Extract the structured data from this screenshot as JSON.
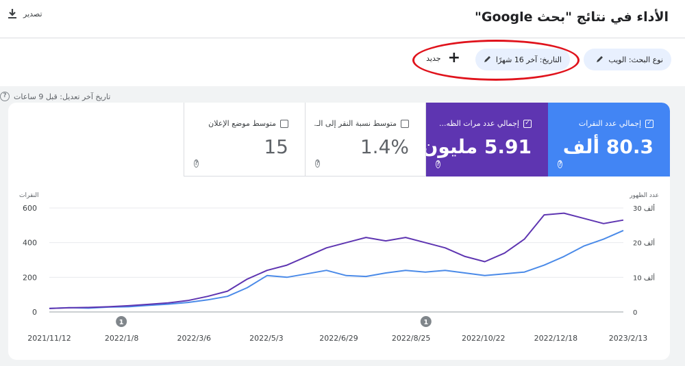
{
  "header": {
    "title": "الأداء في نتائج \"بحث Google\"",
    "export_label": "تصدير"
  },
  "filters": {
    "search_type": "نوع البحث: الويب",
    "date": "التاريخ: آخر 16 شهرًا",
    "add_new": "جديد",
    "last_update": "تاريخ آخر تعديل: قبل 9 ساعات"
  },
  "metrics": [
    {
      "label": "إجمالي عدد النقرات",
      "value": "80.3 ألف",
      "checked": true,
      "color": "#4285f4"
    },
    {
      "label": "إجمالي عدد مرات الظه...",
      "value": "5.91 مليون",
      "checked": true,
      "color": "#5e35b1"
    },
    {
      "label": "متوسط نسبة النقر إلى الـ...",
      "value": "1.4%",
      "checked": false
    },
    {
      "label": "متوسط موضع الإعلان",
      "value": "15",
      "checked": false
    }
  ],
  "chart_data": {
    "type": "line",
    "left_axis_label": "النقرات",
    "right_axis_label": "عدد الظهور",
    "left_ticks": [
      "600",
      "400",
      "200",
      "0"
    ],
    "right_ticks": [
      "30 ألف",
      "20 ألف",
      "10 ألف",
      "0"
    ],
    "x_labels": [
      "2021/11/12",
      "2022/1/8",
      "2022/3/6",
      "2022/5/3",
      "2022/6/29",
      "2022/8/25",
      "2022/10/22",
      "2022/12/18",
      "2023/2/13"
    ],
    "annotations": [
      {
        "label": "1",
        "date": "2022/1/8"
      },
      {
        "label": "1",
        "date": "2022/9/6"
      }
    ],
    "ylim_left": [
      0,
      600
    ],
    "ylim_right": [
      0,
      30000
    ],
    "series": [
      {
        "name": "إجمالي عدد النقرات",
        "axis": "left",
        "color": "#4a8ae8",
        "values": [
          20,
          25,
          22,
          28,
          30,
          38,
          45,
          55,
          70,
          90,
          140,
          210,
          200,
          220,
          240,
          210,
          205,
          225,
          240,
          230,
          240,
          225,
          210,
          220,
          230,
          270,
          320,
          380,
          420,
          470
        ]
      },
      {
        "name": "إجمالي عدد مرات الظه...",
        "axis": "right",
        "color": "#5e35b1",
        "values": [
          1000,
          1200,
          1300,
          1500,
          1800,
          2200,
          2600,
          3300,
          4500,
          6000,
          9500,
          12000,
          13500,
          16000,
          18500,
          20000,
          21500,
          20500,
          21500,
          20000,
          18500,
          16000,
          14500,
          17000,
          21000,
          28000,
          28500,
          27000,
          25500,
          26500
        ]
      }
    ]
  }
}
